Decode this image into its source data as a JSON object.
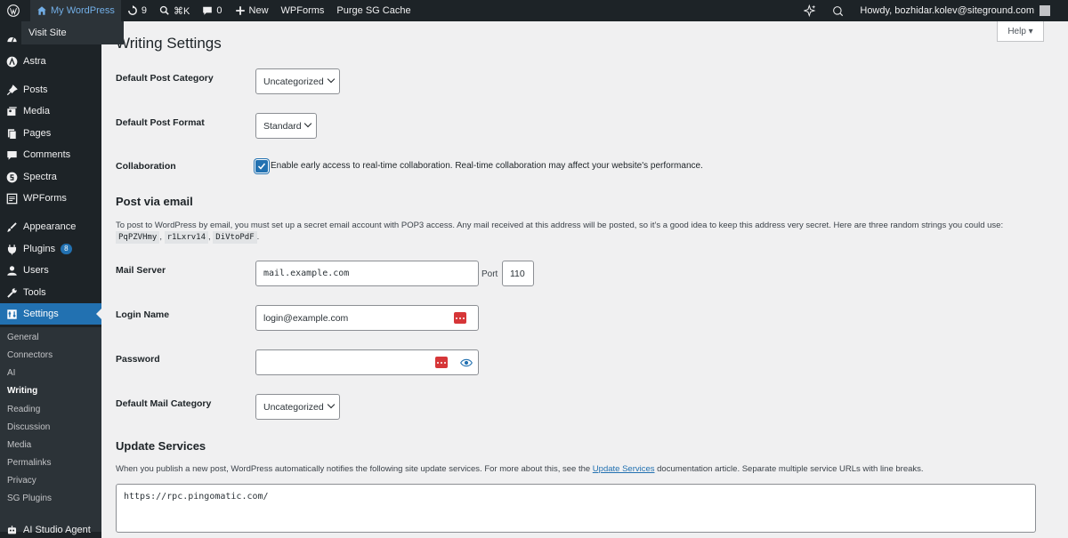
{
  "admin_bar": {
    "site_name": "My WordPress",
    "updates_count": "9",
    "shortcut": "⌘K",
    "comments_count": "0",
    "new_label": "New",
    "wpforms_label": "WPForms",
    "purge_label": "Purge SG Cache",
    "howdy": "Howdy, bozhidar.kolev@siteground.com",
    "visit_site": "Visit Site"
  },
  "sidebar": {
    "items": [
      {
        "label": "Astra",
        "icon": "astra-icon"
      },
      {
        "label": "Posts",
        "icon": "pin-icon"
      },
      {
        "label": "Media",
        "icon": "media-icon"
      },
      {
        "label": "Pages",
        "icon": "pages-icon"
      },
      {
        "label": "Comments",
        "icon": "comment-icon"
      },
      {
        "label": "Spectra",
        "icon": "spectra-icon"
      },
      {
        "label": "WPForms",
        "icon": "wpforms-icon"
      },
      {
        "label": "Appearance",
        "icon": "brush-icon"
      },
      {
        "label": "Plugins",
        "icon": "plugin-icon"
      },
      {
        "label": "Users",
        "icon": "user-icon"
      },
      {
        "label": "Tools",
        "icon": "wrench-icon"
      },
      {
        "label": "Settings",
        "icon": "settings-icon"
      },
      {
        "label": "AI Studio Agent",
        "icon": "ai-icon"
      }
    ],
    "plugins_badge": "8",
    "submenu": [
      "General",
      "Connectors",
      "AI",
      "Writing",
      "Reading",
      "Discussion",
      "Media",
      "Permalinks",
      "Privacy",
      "SG Plugins"
    ]
  },
  "page": {
    "title": "Writing Settings",
    "help_label": "Help ▾",
    "default_post_category_label": "Default Post Category",
    "default_post_category_value": "Uncategorized",
    "default_post_format_label": "Default Post Format",
    "default_post_format_value": "Standard",
    "collaboration_label": "Collaboration",
    "collaboration_text": "Enable early access to real-time collaboration. Real-time collaboration may affect your website's performance.",
    "post_via_email_title": "Post via email",
    "post_via_email_desc": "To post to WordPress by email, you must set up a secret email account with POP3 access. Any mail received at this address will be posted, so it’s a good idea to keep this address very secret. Here are three random strings you could use:",
    "random_strings": [
      "PqPZVHmy",
      "r1Lxrv14",
      "DiVtoPdF"
    ],
    "mail_server_label": "Mail Server",
    "mail_server_value": "mail.example.com",
    "port_label": "Port",
    "port_value": "110",
    "login_name_label": "Login Name",
    "login_name_value": "login@example.com",
    "password_label": "Password",
    "password_value": "",
    "default_mail_category_label": "Default Mail Category",
    "default_mail_category_value": "Uncategorized",
    "update_services_title": "Update Services",
    "update_services_desc_before": "When you publish a new post, WordPress automatically notifies the following site update services. For more about this, see the ",
    "update_services_link": "Update Services",
    "update_services_desc_after": " documentation article. Separate multiple service URLs with line breaks.",
    "ping_sites_value": "https://rpc.pingomatic.com/"
  },
  "colors": {
    "accent": "#2271b1",
    "admin_bg": "#1d2327",
    "password_manager": "#d63638"
  }
}
